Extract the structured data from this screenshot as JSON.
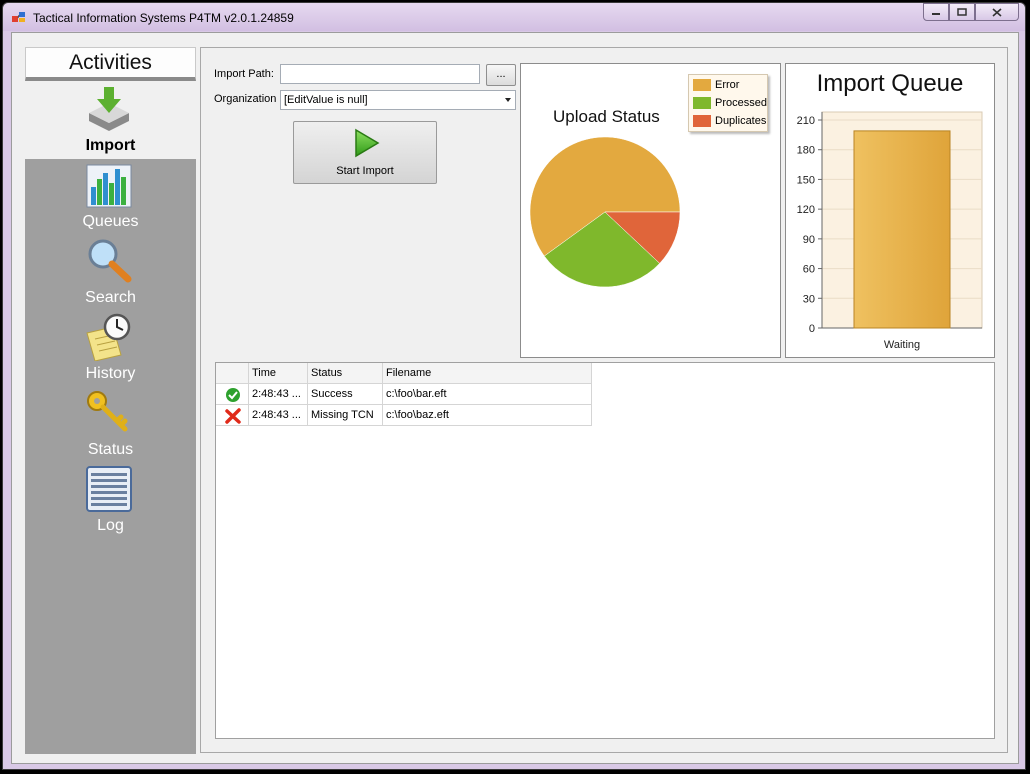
{
  "window": {
    "title": "Tactical Information Systems P4TM v2.0.1.24859"
  },
  "sidebar": {
    "header": "Activities",
    "items": [
      {
        "label": "Import",
        "icon": "import-icon",
        "selected": true
      },
      {
        "label": "Queues",
        "icon": "bar-chart-icon",
        "selected": false
      },
      {
        "label": "Search",
        "icon": "magnifier-icon",
        "selected": false
      },
      {
        "label": "History",
        "icon": "clock-notes-icon",
        "selected": false
      },
      {
        "label": "Status",
        "icon": "keys-icon",
        "selected": false
      },
      {
        "label": "Log",
        "icon": "log-list-icon",
        "selected": false
      }
    ]
  },
  "import_form": {
    "path_label": "Import Path:",
    "path_value": "",
    "browse_label": "...",
    "org_label": "Organization",
    "org_value": "[EditValue is null]",
    "start_label": "Start Import"
  },
  "chart_data": [
    {
      "type": "pie",
      "title": "Upload Status",
      "legend": [
        "Error",
        "Processed",
        "Duplicates"
      ],
      "legend_position": "top-right",
      "values": [
        60,
        28,
        12
      ],
      "colors": [
        "#e3a93f",
        "#7fb82c",
        "#e0653a"
      ]
    },
    {
      "type": "bar",
      "title": "Import Queue",
      "categories": [
        "Waiting"
      ],
      "values": [
        199
      ],
      "ylim": [
        0,
        210
      ],
      "yticks": [
        0,
        30,
        60,
        90,
        120,
        150,
        180,
        210
      ],
      "colors": [
        "#dfa43a"
      ]
    }
  ],
  "grid": {
    "columns": [
      "",
      "Time",
      "Status",
      "Filename"
    ],
    "rows": [
      {
        "status_icon": "success-check-icon",
        "time": "2:48:43 ...",
        "status": "Success",
        "filename": "c:\\foo\\bar.eft"
      },
      {
        "status_icon": "error-x-icon",
        "time": "2:48:43 ...",
        "status": "Missing TCN",
        "filename": "c:\\foo\\baz.eft"
      }
    ]
  }
}
